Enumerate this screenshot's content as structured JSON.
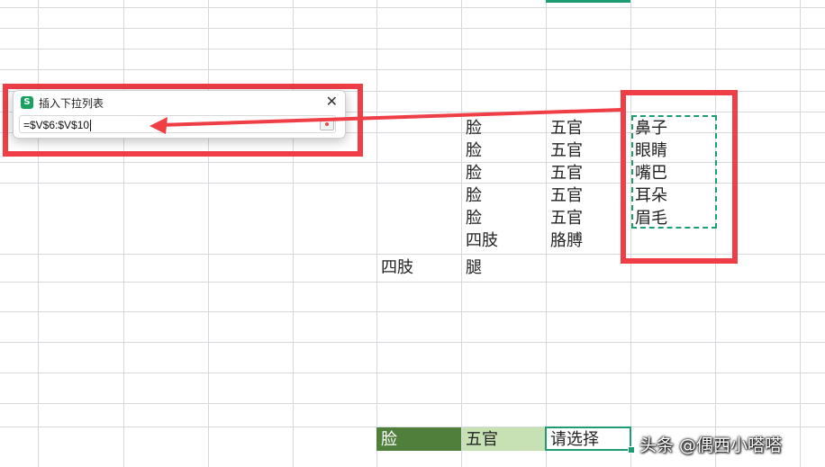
{
  "dialog": {
    "title": "插入下拉列表",
    "close_symbol": "✕",
    "icon_letter": "S",
    "input_value": "=$V$6:$V$10"
  },
  "cells": {
    "t_col": [
      "脸",
      "脸",
      "脸",
      "脸",
      "脸",
      "四肢"
    ],
    "u_col": [
      "五官",
      "五官",
      "五官",
      "五官",
      "五官",
      "胳膊"
    ],
    "v_col": [
      "鼻子",
      "眼睛",
      "嘴巴",
      "耳朵",
      "眉毛"
    ],
    "row12": {
      "s": "四肢",
      "t": "腿"
    }
  },
  "bottom_row": {
    "cell1": "脸",
    "cell2": "五官",
    "cell3": "请选择"
  },
  "watermark": "头条 @偶西小嗒嗒",
  "colors": {
    "annotation_red": "#ef3e46",
    "selection_green": "#1e9d74",
    "dark_green_fill": "#4f7f3b",
    "light_green_fill": "#c7e1b4",
    "gridline": "#d6d9de"
  }
}
